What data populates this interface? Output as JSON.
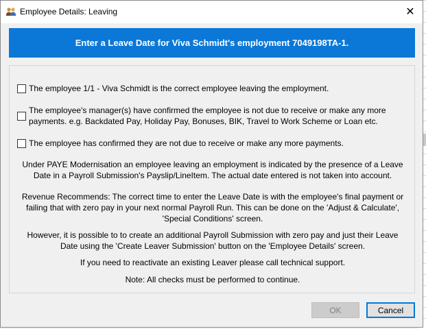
{
  "window": {
    "title": "Employee Details: Leaving",
    "close_glyph": "✕"
  },
  "banner": {
    "text": "Enter a Leave Date for Viva Schmidt's employment 7049198TA-1."
  },
  "checks": [
    {
      "checked": false,
      "lines": [
        "The employee 1/1 - Viva Schmidt is the correct employee leaving the employment."
      ]
    },
    {
      "checked": false,
      "lines": [
        "The employee's manager(s) have confirmed the employee is not due to receive or make any more",
        "payments. e.g. Backdated Pay, Holiday Pay, Bonuses, BIK, Travel to Work Scheme or Loan etc."
      ]
    },
    {
      "checked": false,
      "lines": [
        "The employee has confirmed they are not due to receive or make any more payments."
      ]
    }
  ],
  "info": {
    "paye": [
      "Under PAYE Modernisation an employee leaving an employment is indicated by the presence of a Leave",
      "Date in a Payroll Submission's Payslip/LineItem.  The actual date entered is not taken into account."
    ],
    "revenue": [
      "Revenue Recommends: The correct time to enter the Leave Date is with the employee's final payment or",
      "failing that with zero pay in your next normal Payroll Run.  This can be done on the 'Adjust & Calculate',",
      "'Special Conditions' screen."
    ],
    "however": [
      "However, it is possible to to create an additional Payroll Submission with zero pay and just their Leave",
      "Date using the 'Create Leaver Submission' button on the 'Employee Details' screen."
    ],
    "reactivate": "If you need to reactivate an existing Leaver please call technical support.",
    "note": "Note: All checks must be performed to continue."
  },
  "buttons": {
    "ok_label": "OK",
    "ok_enabled": false,
    "cancel_label": "Cancel"
  },
  "icons": {
    "title": "people-icon",
    "close": "close-icon",
    "checkbox": "checkbox-icon"
  },
  "colors": {
    "banner": "#0b78d7",
    "banner_text": "#ffffff",
    "dialog_bg": "#f0f0f0",
    "focus_border": "#0078d7"
  }
}
